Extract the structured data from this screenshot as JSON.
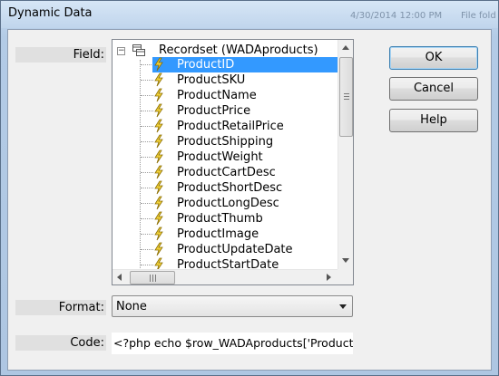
{
  "window": {
    "title": "Dynamic Data",
    "background_text": [
      "4/30/2014 12:00 PM",
      "File fold"
    ]
  },
  "labels": {
    "field": "Field:",
    "format": "Format:",
    "code": "Code:"
  },
  "tree": {
    "root_label": "Recordset (WADAproducts)",
    "expander_symbol": "−",
    "selected_item": "ProductID",
    "items": [
      "ProductID",
      "ProductSKU",
      "ProductName",
      "ProductPrice",
      "ProductRetailPrice",
      "ProductShipping",
      "ProductWeight",
      "ProductCartDesc",
      "ProductShortDesc",
      "ProductLongDesc",
      "ProductThumb",
      "ProductImage",
      "ProductUpdateDate",
      "ProductStartDate"
    ],
    "item_icon": "lightning-bolt-icon",
    "root_icon": "recordset-icon"
  },
  "buttons": {
    "ok": "OK",
    "cancel": "Cancel",
    "help": "Help"
  },
  "format": {
    "selected": "None"
  },
  "code": {
    "value": "<?php echo $row_WADAproducts['ProductID']; ?>"
  },
  "colors": {
    "selection": "#3399ff",
    "dialog_bg": "#f0f0f0",
    "titlebar": "#c9dcf0"
  }
}
